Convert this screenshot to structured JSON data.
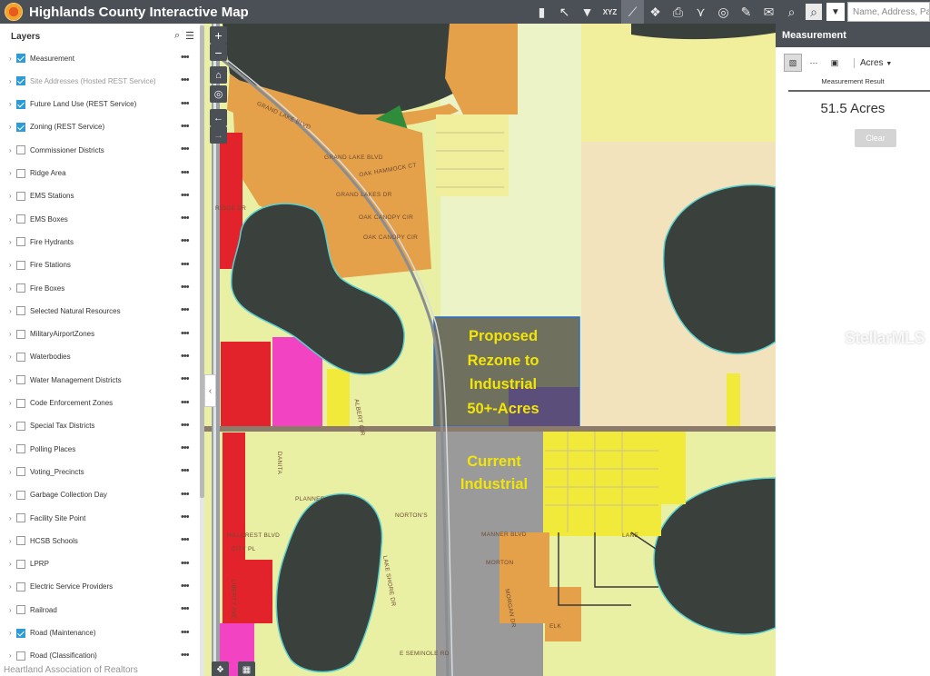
{
  "app": {
    "title": "Highlands County Interactive Map"
  },
  "search": {
    "placeholder": "Name, Address, Parc"
  },
  "toolbar": {
    "tools": [
      "bookmark-icon",
      "select-icon",
      "filter-icon",
      "xyz-icon",
      "measure-icon",
      "layers-icon",
      "print-icon",
      "share-icon",
      "compass-icon",
      "draw-icon",
      "mail-icon",
      "identify-icon",
      "zoom-icon"
    ],
    "xyz_label": "XYZ"
  },
  "layers": {
    "title": "Layers",
    "items": [
      {
        "label": "Measurement",
        "checked": true,
        "dim": false
      },
      {
        "label": "Site Addresses (Hosted REST Service)",
        "checked": true,
        "dim": true
      },
      {
        "label": "Future Land Use (REST Service)",
        "checked": true,
        "dim": false
      },
      {
        "label": "Zoning (REST Service)",
        "checked": true,
        "dim": false
      },
      {
        "label": "Commissioner Districts",
        "checked": false,
        "dim": false
      },
      {
        "label": "Ridge Area",
        "checked": false,
        "dim": false
      },
      {
        "label": "EMS Stations",
        "checked": false,
        "dim": false
      },
      {
        "label": "EMS Boxes",
        "checked": false,
        "dim": false
      },
      {
        "label": "Fire Hydrants",
        "checked": false,
        "dim": false
      },
      {
        "label": "Fire Stations",
        "checked": false,
        "dim": false
      },
      {
        "label": "Fire Boxes",
        "checked": false,
        "dim": false
      },
      {
        "label": "Selected Natural Resources",
        "checked": false,
        "dim": false
      },
      {
        "label": "MilitaryAirportZones",
        "checked": false,
        "dim": false
      },
      {
        "label": "Waterbodies",
        "checked": false,
        "dim": false
      },
      {
        "label": "Water Management Districts",
        "checked": false,
        "dim": false
      },
      {
        "label": "Code Enforcement Zones",
        "checked": false,
        "dim": false
      },
      {
        "label": "Special Tax Districts",
        "checked": false,
        "dim": false
      },
      {
        "label": "Polling Places",
        "checked": false,
        "dim": false
      },
      {
        "label": "Voting_Precincts",
        "checked": false,
        "dim": false
      },
      {
        "label": "Garbage Collection Day",
        "checked": false,
        "dim": false
      },
      {
        "label": "Facility Site Point",
        "checked": false,
        "dim": false
      },
      {
        "label": "HCSB Schools",
        "checked": false,
        "dim": false
      },
      {
        "label": "LPRP",
        "checked": false,
        "dim": false
      },
      {
        "label": "Electric Service Providers",
        "checked": false,
        "dim": false
      },
      {
        "label": "Railroad",
        "checked": false,
        "dim": false
      },
      {
        "label": "Road (Maintenance)",
        "checked": true,
        "dim": false
      },
      {
        "label": "Road (Classification)",
        "checked": false,
        "dim": false
      }
    ]
  },
  "map": {
    "zoom_in": "+",
    "zoom_out": "−",
    "rezone_lines": [
      "Proposed",
      "Rezone to",
      "Industrial",
      "50+-Acres"
    ],
    "current_lines": [
      "Current",
      "Industrial"
    ],
    "streets": [
      "GRAND LAKE BLVD",
      "GRAND LAKE BLVD",
      "OAK HAMMOCK CT",
      "GRAND LAKES DR",
      "OAK CANOPY CIR",
      "OAK CANOPY CIR",
      "RIDGE DR",
      "ALBERT CIR",
      "PLANNER",
      "NORTON'S",
      "DANITA",
      "MANNER BLVD",
      "LANE",
      "MORTON",
      "MORGAN DR",
      "ELK",
      "LAKE SHORE DR",
      "HILLCREST BLVD",
      "CITY PL",
      "LIBERTY AVE",
      "E SEMINOLE RD"
    ]
  },
  "measurement": {
    "title": "Measurement",
    "unit": "Acres",
    "result_label": "Measurement Result",
    "result_value": "51.5 Acres",
    "clear_label": "Clear"
  },
  "watermarks": {
    "stellar": "StellarMLS",
    "heartland": "Heartland Association of Realtors"
  },
  "colors": {
    "header": "#4b4f56",
    "checkbox_on": "#2e9bd6",
    "label_yellow": "#f2e50a",
    "water": "#3f4640",
    "residential": "#e9f0a4",
    "commercial_orange": "#e5a04a",
    "industrial_gray": "#9a9a9a",
    "red": "#e3232b",
    "magenta": "#f243c2"
  }
}
